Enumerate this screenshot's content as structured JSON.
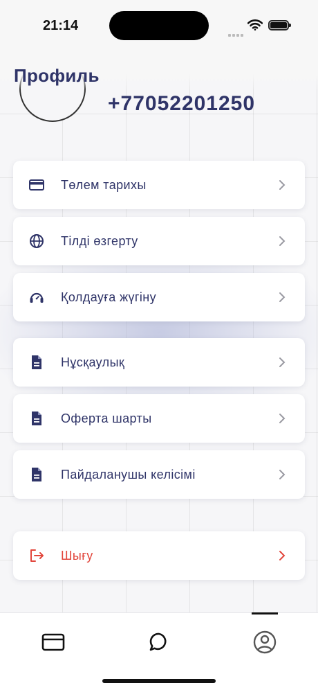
{
  "status_bar": {
    "time": "21:14"
  },
  "header": {
    "title": "Профиль",
    "phone": "+77052201250"
  },
  "menu": [
    {
      "label": "Төлем тарихы",
      "icon": "credit-card-icon"
    },
    {
      "label": "Тілді өзгерту",
      "icon": "globe-icon"
    },
    {
      "label": "Қолдауға жүгіну",
      "icon": "support-headset-icon"
    },
    {
      "label": "Нұсқаулық",
      "icon": "document-icon"
    },
    {
      "label": "Оферта шарты",
      "icon": "document-icon"
    },
    {
      "label": "Пайдаланушы келісімі",
      "icon": "document-icon"
    }
  ],
  "logout": {
    "label": "Шығу",
    "icon": "logout-icon"
  },
  "tabbar": {
    "tabs": [
      {
        "icon": "card-icon"
      },
      {
        "icon": "chat-bubble-icon"
      },
      {
        "icon": "profile-icon",
        "active": true
      }
    ]
  },
  "colors": {
    "primary": "#2f3468",
    "danger": "#e2463c",
    "chevron": "#9a9aa2"
  }
}
